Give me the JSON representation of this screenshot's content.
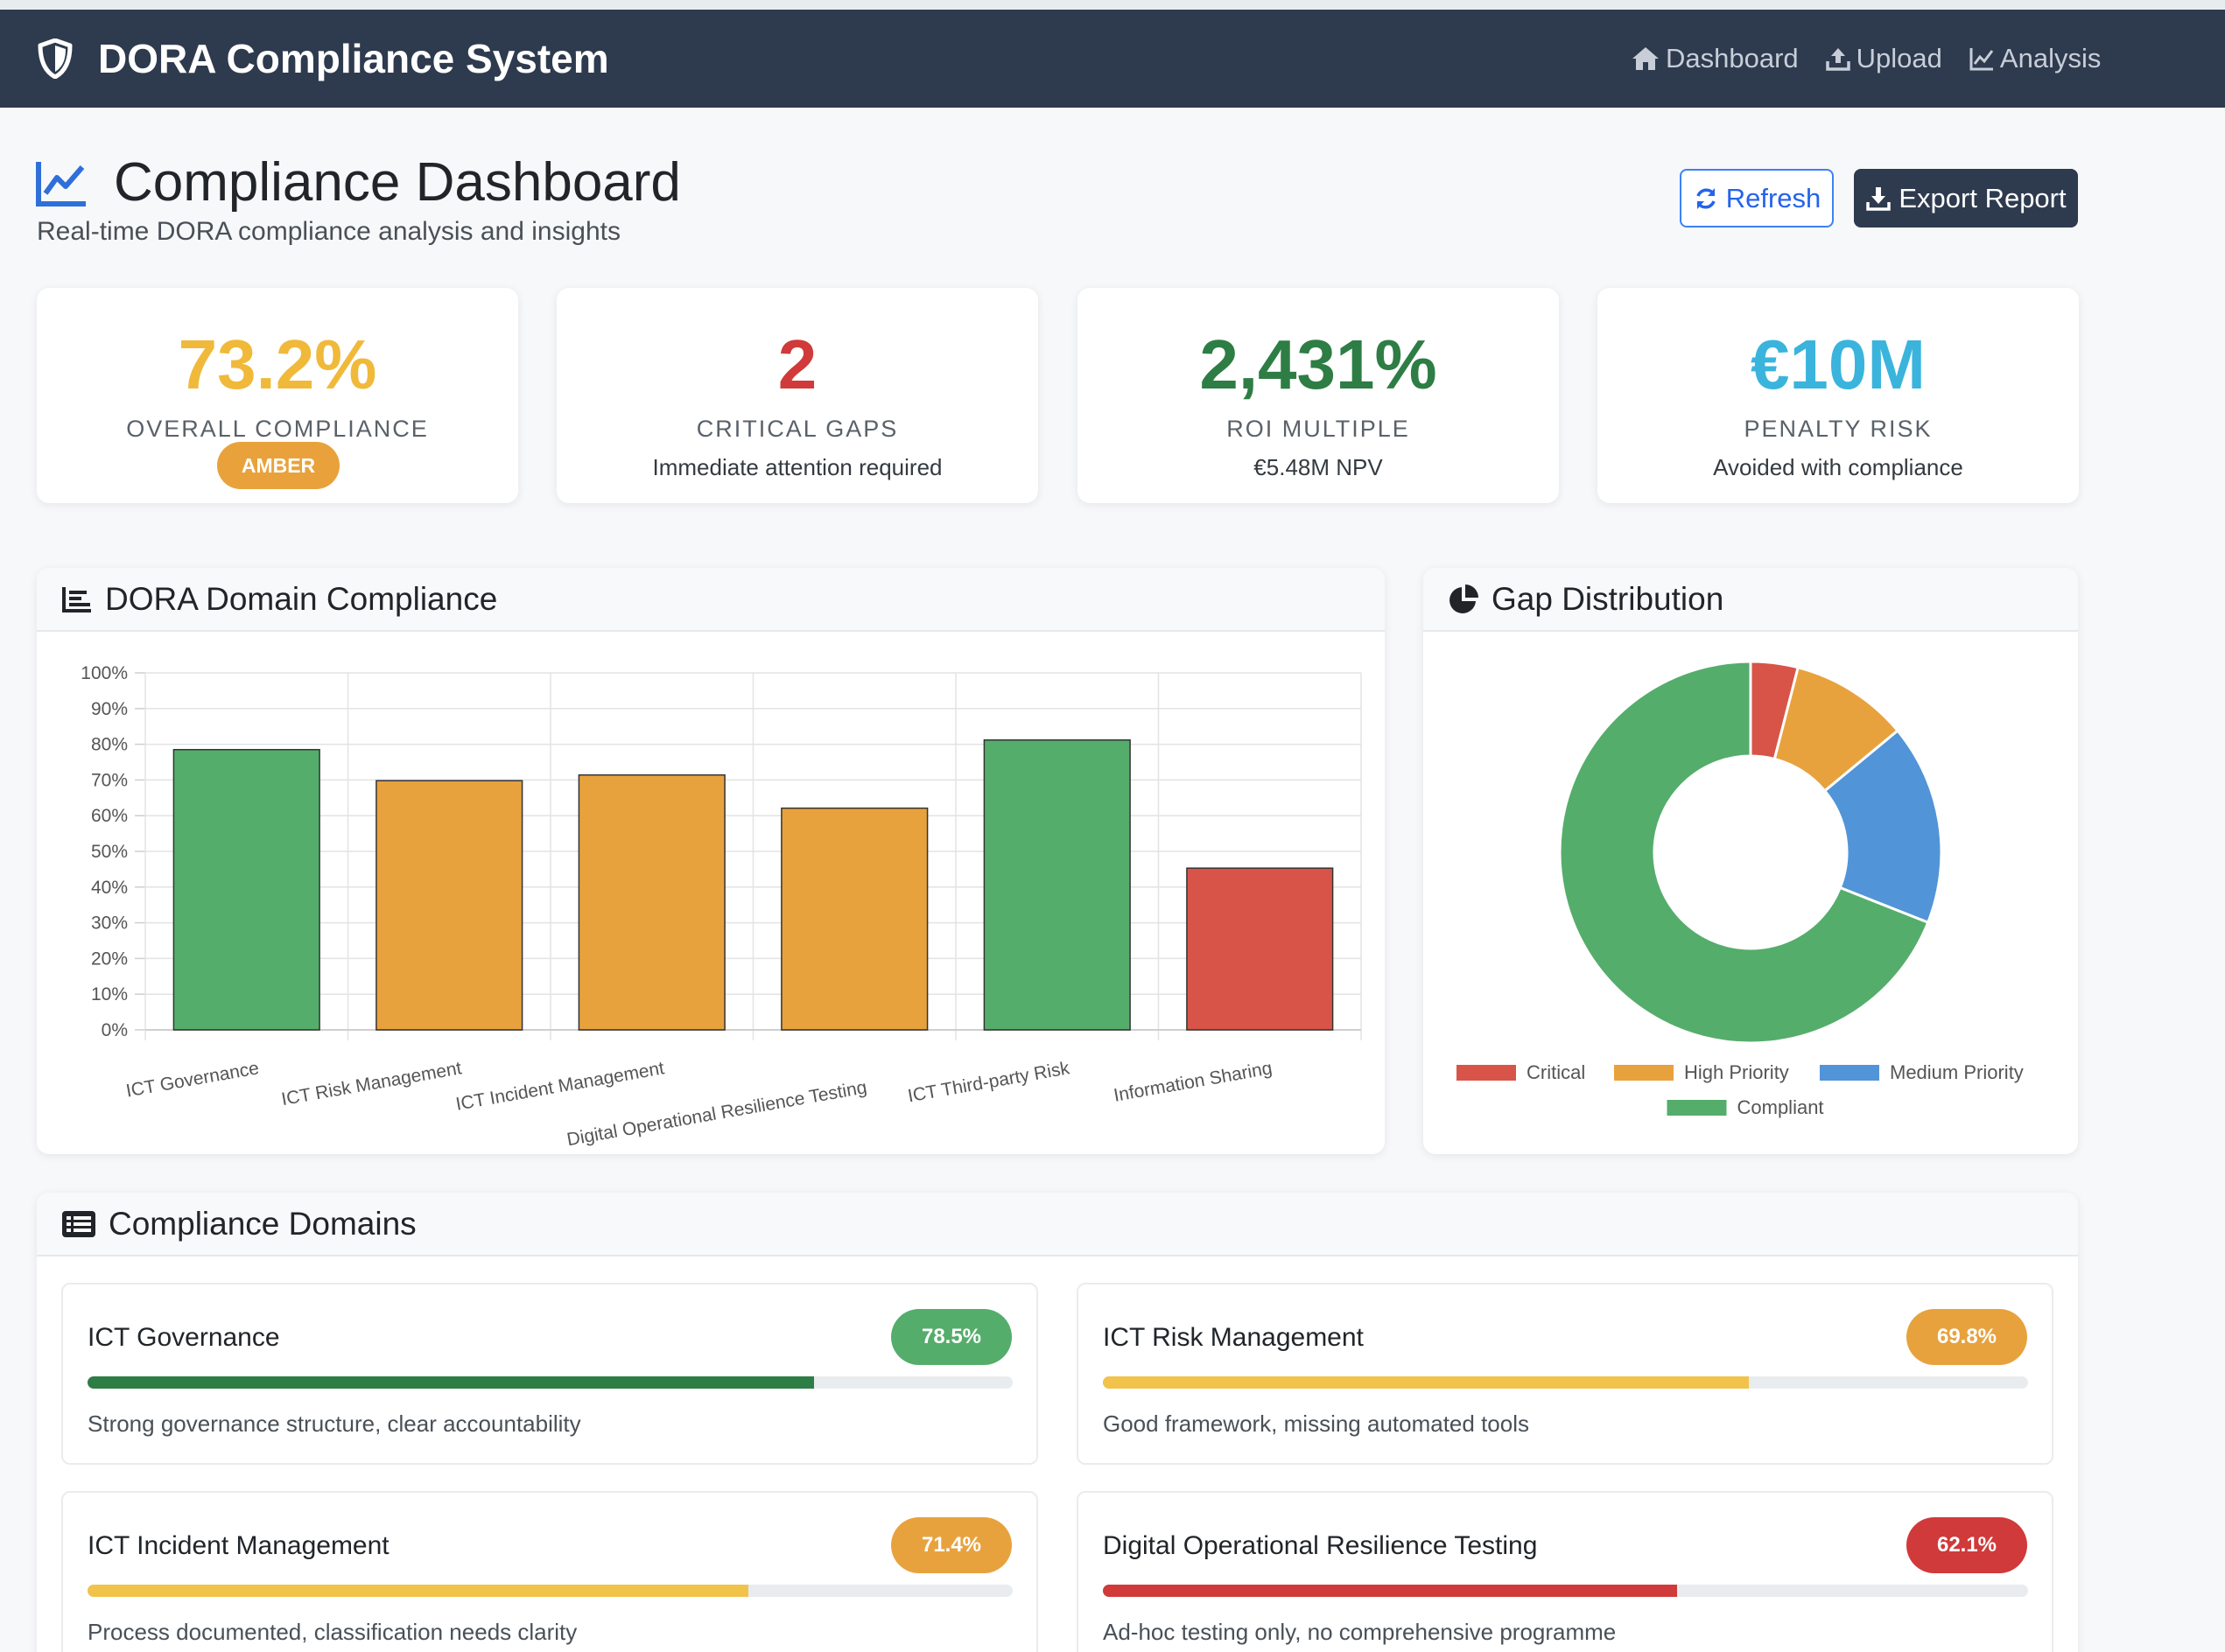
{
  "navbar": {
    "brand": "DORA Compliance System",
    "links": [
      "Dashboard",
      "Upload",
      "Analysis"
    ]
  },
  "header": {
    "title": "Compliance Dashboard",
    "subtitle": "Real-time DORA compliance analysis and insights",
    "refresh_label": "Refresh",
    "export_label": "Export Report"
  },
  "stats": [
    {
      "value": "73.2%",
      "label": "OVERALL COMPLIANCE",
      "badge": "AMBER",
      "color": "#f0b93a"
    },
    {
      "value": "2",
      "label": "CRITICAL GAPS",
      "sub": "Immediate attention required",
      "color": "#d03a3a"
    },
    {
      "value": "2,431%",
      "label": "ROI MULTIPLE",
      "sub": "€5.48M NPV",
      "color": "#2e7d45"
    },
    {
      "value": "€10M",
      "label": "PENALTY RISK",
      "sub": "Avoided with compliance",
      "color": "#3ab4dc"
    }
  ],
  "bar_panel": {
    "title": "DORA Domain Compliance"
  },
  "pie_panel": {
    "title": "Gap Distribution"
  },
  "domains_panel": {
    "title": "Compliance Domains"
  },
  "chart_data": [
    {
      "type": "bar",
      "categories": [
        "ICT Governance",
        "ICT Risk Management",
        "ICT Incident Management",
        "Digital Operational Resilience Testing",
        "ICT Third-party Risk",
        "Information Sharing"
      ],
      "values": [
        78.5,
        69.8,
        71.4,
        62.1,
        81.2,
        45.3
      ],
      "colors": [
        "#55ad6b",
        "#e8a23d",
        "#e8a23d",
        "#e8a23d",
        "#55ad6b",
        "#d85448"
      ],
      "ylim": [
        0,
        100
      ],
      "yticks": [
        "0%",
        "10%",
        "20%",
        "30%",
        "40%",
        "50%",
        "60%",
        "70%",
        "80%",
        "90%",
        "100%"
      ],
      "grid": true
    },
    {
      "type": "pie",
      "categories": [
        "Critical",
        "High Priority",
        "Medium Priority",
        "Compliant"
      ],
      "values": [
        4,
        10,
        17,
        69
      ],
      "colors": [
        "#d85448",
        "#e8a23d",
        "#5294d8",
        "#55ad6b"
      ],
      "legend": "bottom"
    }
  ],
  "domains": [
    {
      "name": "ICT Governance",
      "score": "78.5%",
      "value": 78.5,
      "desc": "Strong governance structure, clear accountability",
      "badge_color": "#55ad6b",
      "bar_color": "#2e7d45"
    },
    {
      "name": "ICT Risk Management",
      "score": "69.8%",
      "value": 69.8,
      "desc": "Good framework, missing automated tools",
      "badge_color": "#e8a23d",
      "bar_color": "#f2c34a"
    },
    {
      "name": "ICT Incident Management",
      "score": "71.4%",
      "value": 71.4,
      "desc": "Process documented, classification needs clarity",
      "badge_color": "#e8a23d",
      "bar_color": "#f2c34a"
    },
    {
      "name": "Digital Operational Resilience Testing",
      "score": "62.1%",
      "value": 62.1,
      "desc": "Ad-hoc testing only, no comprehensive programme",
      "badge_color": "#d03a3a",
      "bar_color": "#d03a3a"
    }
  ]
}
